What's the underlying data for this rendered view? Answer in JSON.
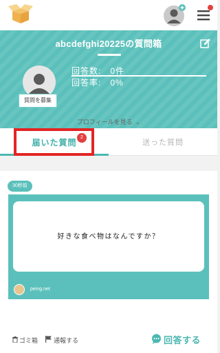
{
  "topbar": {
    "logo_icon": "open-box-logo",
    "avatar_icon": "user-avatar-with-plus-icon",
    "menu_icon": "hamburger-menu-icon",
    "menu_has_notification": true
  },
  "header": {
    "title": "abcdefghi20225の質問箱",
    "edit_icon": "pencil-edit-icon",
    "recruit_button_label": "質問を募集",
    "answer_count": "回答数:　0件",
    "answer_rate": "回答率:　0%"
  },
  "profile_link": {
    "label": "プロフィールを見る",
    "chevron": "⌄"
  },
  "tabs": [
    {
      "label": "届いた質問",
      "badge": "2",
      "active": true
    },
    {
      "label": "送った質問",
      "active": false
    }
  ],
  "question_card": {
    "time_badge": "30秒前",
    "question": "好きな食べ物はなんですか？",
    "source_label": "peing.net"
  },
  "card_actions": {
    "trash_label": "ゴミ箱",
    "report_label": "通報する",
    "answer_label": "回答する"
  },
  "colors": {
    "teal": "#5bc0bb",
    "teal_text": "#3fb0a8",
    "highlight_red": "#e32424",
    "badge_red": "#e34040"
  }
}
